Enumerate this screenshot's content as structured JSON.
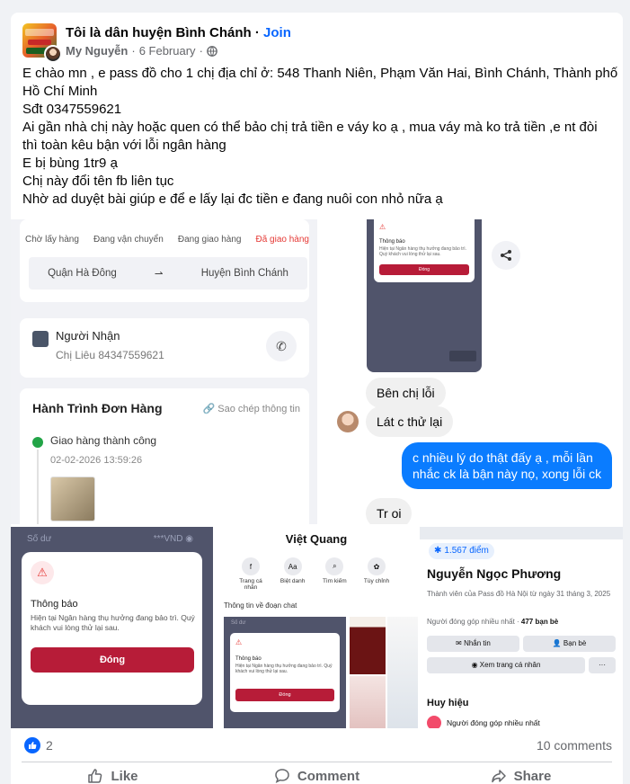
{
  "post": {
    "group_name": "Tôi là dân huyện Bình Chánh",
    "separator": " · ",
    "join_label": "Join",
    "author": "My Nguyễn",
    "date": "6 February",
    "body_lines": [
      "E chào mn , e pass đồ cho 1 chị địa chỉ ở:  548 Thanh Niên, Phạm Văn Hai, Bình Chánh, Thành phố",
      "Hồ Chí Minh",
      "Sđt 0347559621",
      "Ai gần nhà chị này hoặc quen có thể bảo chị trả tiền e váy ko ạ , mua váy mà ko trả tiền ,e nt đòi",
      "thì toàn kêu bận với lỗi ngân hàng",
      "E bị bùng 1tr9 ạ",
      "Chị này đổi tên fb liên tục",
      "Nhờ ad duyệt bài giúp e để e lấy lại đc tiền e đang nuôi con nhỏ nữa ạ"
    ]
  },
  "img_order": {
    "steps": [
      "Chờ lấy hàng",
      "Đang vận chuyển",
      "Đang giao hàng",
      "Đã giao hàng"
    ],
    "from": "Quận Hà Đông",
    "to": "Huyện Bình Chánh",
    "recipient_title": "Người Nhận",
    "recipient_value": "Chị Liêu 84347559621",
    "journey_title": "Hành Trình Đơn Hàng",
    "copy_label": "Sao chép thông tin",
    "status": "Giao hàng thành công",
    "timestamp": "02-02-2026 13:59:26"
  },
  "img_chat": {
    "mini_title": "Thông báo",
    "mini_body": "Hiện tại Ngân hàng thụ hưởng đang bảo trì. Quý khách vui lòng thử lại sau.",
    "mini_button": "Đóng",
    "msg1": "Bên chị lỗi",
    "msg2": "Lát c thử lại",
    "msg3_line1": "c nhiều lý do thật đấy ạ , mỗi lần",
    "msg3_line2": "nhắc ck là bận này nọ, xong lỗi ck",
    "msg4": "Tr oi"
  },
  "img_bank": {
    "balance_label": "Số dư",
    "balance_value": "***VND",
    "dialog_title": "Thông báo",
    "dialog_body": "Hiện tại Ngân hàng thụ hưởng đang bảo trì. Quý khách vui lòng thử lại sau.",
    "dialog_button": "Đóng"
  },
  "img_profile_chat": {
    "name": "Việt Quang",
    "actions": [
      "Trang cá nhân",
      "Biệt danh",
      "Tìm kiếm",
      "Tùy chỉnh"
    ],
    "action_icons": [
      "facebook-icon",
      "text-icon",
      "search-icon",
      "palette-icon"
    ],
    "info_label": "Thông tin về đoạn chat",
    "mini_title": "Thông báo",
    "mini_body": "Hiện tại Ngân hàng thụ hưởng đang bảo trì. Quý khách vui lòng thử lại sau.",
    "mini_button": "Đóng"
  },
  "img_fb_profile": {
    "points": "1.567 điểm",
    "name": "Nguyễn Ngọc Phương",
    "member_line": "Thành viên của Pass đồ Hà Nội từ ngày 31 tháng 3, 2025",
    "contributor": "Người đóng góp nhiều nhất",
    "friends": "477 bạn bè",
    "btn_message": "Nhắn tin",
    "btn_friends": "Bạn bè",
    "btn_profile": "Xem trang cá nhân",
    "btn_more": "···",
    "badges_title": "Huy hiệu",
    "badge_item": "Người đóng góp nhiều nhất"
  },
  "footer": {
    "reaction_count": "2",
    "comments": "10 comments",
    "like": "Like",
    "comment": "Comment",
    "share": "Share"
  },
  "colors": {
    "brand_blue": "#0866ff",
    "messenger_blue": "#0a7cff",
    "danger_red": "#b71c38",
    "success_green": "#22a447"
  }
}
